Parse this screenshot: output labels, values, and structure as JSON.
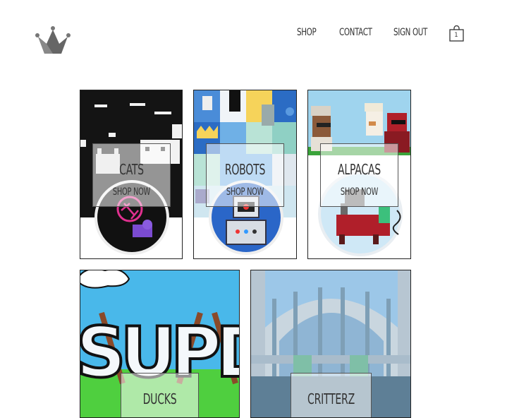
{
  "nav": {
    "shop": "SHOP",
    "contact": "CONTACT",
    "sign_out": "SIGN OUT"
  },
  "cart": {
    "count": "1"
  },
  "categories": [
    {
      "title": "CATS",
      "cta": "SHOP NOW"
    },
    {
      "title": "ROBOTS",
      "cta": "SHOP NOW"
    },
    {
      "title": "ALPACAS",
      "cta": "SHOP NOW"
    },
    {
      "title": "DUCKS"
    },
    {
      "title": "CRITTERZ"
    }
  ],
  "ducks_banner_text": "SUPDU"
}
